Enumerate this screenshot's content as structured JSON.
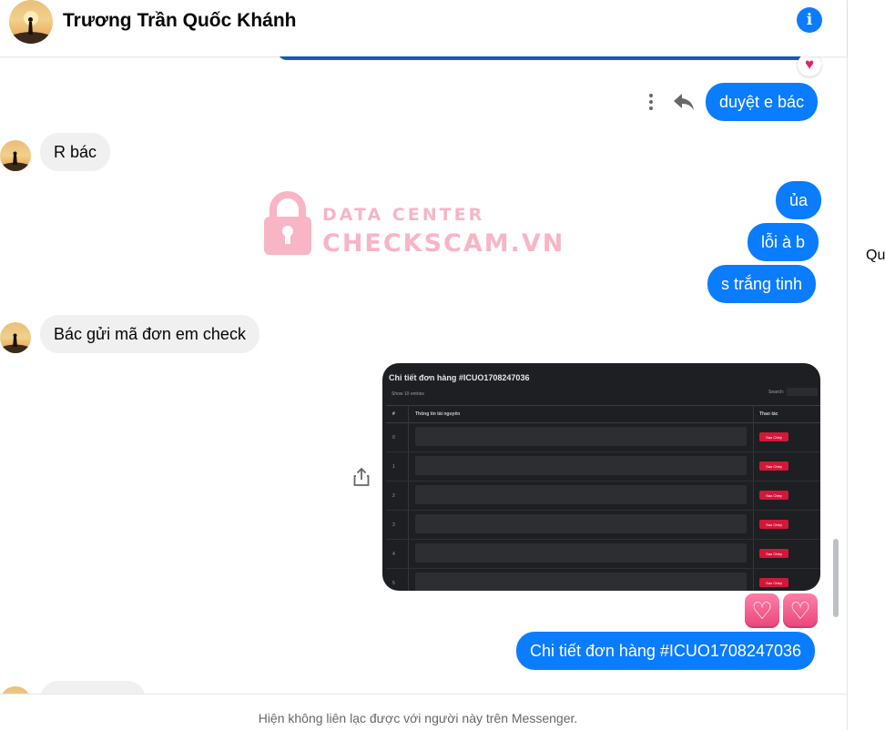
{
  "header": {
    "contact_name": "Trương Trần Quốc Khánh",
    "info_icon": "info-icon"
  },
  "messages": {
    "m1": "duyệt e bác",
    "m2": "R bác",
    "m3": "ủa",
    "m4": "lỗi à b",
    "m5": "s trắng tinh",
    "m6": "Bác gửi mã đơn em check",
    "m7": "Chi tiết đơn hàng #ICUO1708247036"
  },
  "watermark": {
    "line1": "DATA CENTER",
    "line2": "CHECKSCAM.VN"
  },
  "media": {
    "title": "Chi tiết đơn hàng #ICUO1708247036",
    "show_label": "Show  10  entries",
    "search_label": "Search:",
    "col_num": "#",
    "col_info": "Thông tin tài nguyên",
    "col_action": "Thao tác",
    "button_label": "Sao Chép",
    "rows": [
      "0",
      "1",
      "2",
      "3",
      "4",
      "5"
    ]
  },
  "right_panel": {
    "text": "Qu"
  },
  "footer": {
    "notice": "Hiện không liên lạc được với người này trên Messenger."
  },
  "colors": {
    "outgoing": "#0a7cff",
    "incoming": "#f0f0f0",
    "watermark": "#f27a98"
  }
}
